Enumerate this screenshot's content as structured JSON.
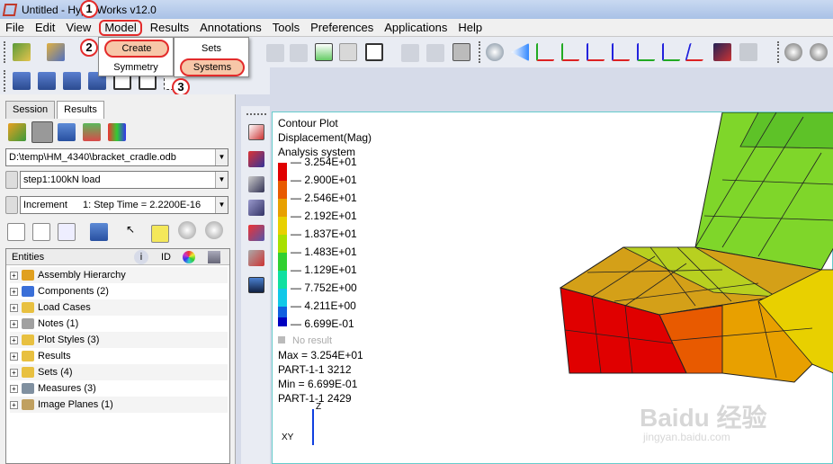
{
  "window": {
    "title": "Untitled - HyperWorks v12.0"
  },
  "menubar": {
    "items": [
      "File",
      "Edit",
      "View",
      "Model",
      "Results",
      "Annotations",
      "Tools",
      "Preferences",
      "Applications",
      "Help"
    ],
    "active": "Model"
  },
  "model_menu": {
    "items": [
      "Create",
      "Symmetry"
    ]
  },
  "create_submenu": {
    "items": [
      "Sets",
      "Systems"
    ]
  },
  "steps": [
    "1",
    "2",
    "3"
  ],
  "left_panel": {
    "tabs": [
      "Session",
      "Results"
    ],
    "file_path": "D:\\temp\\HM_4340\\bracket_cradle.odb",
    "step_value": "step1:100kN load",
    "increment_label": "Increment",
    "increment_value": "1: Step Time =  2.2200E-16",
    "entities_header": {
      "entities": "Entities",
      "id": "ID"
    },
    "entities": [
      {
        "label": "Assembly Hierarchy",
        "color": "#e0a020"
      },
      {
        "label": "Components (2)",
        "color": "#3a6fd8"
      },
      {
        "label": "Load Cases",
        "color": "#e8c040"
      },
      {
        "label": "Notes (1)",
        "color": "#a0a0a0"
      },
      {
        "label": "Plot Styles (3)",
        "color": "#e8c040"
      },
      {
        "label": "Results",
        "color": "#e8c040"
      },
      {
        "label": "Sets  (4)",
        "color": "#e8c040"
      },
      {
        "label": "Measures (3)",
        "color": "#8090a0"
      },
      {
        "label": "Image Planes (1)",
        "color": "#c0a060"
      }
    ]
  },
  "contour": {
    "title_lines": [
      "Contour Plot",
      "Displacement(Mag)",
      "Analysis system"
    ],
    "legend": [
      {
        "value": "3.254E+01",
        "color": "#e00000"
      },
      {
        "value": "2.900E+01",
        "color": "#e85a00"
      },
      {
        "value": "2.546E+01",
        "color": "#e8a000"
      },
      {
        "value": "2.192E+01",
        "color": "#e8d000"
      },
      {
        "value": "1.837E+01",
        "color": "#a8e000"
      },
      {
        "value": "1.483E+01",
        "color": "#30d030"
      },
      {
        "value": "1.129E+01",
        "color": "#10e0a0"
      },
      {
        "value": "7.752E+00",
        "color": "#10c8e8"
      },
      {
        "value": "4.211E+00",
        "color": "#1060e0"
      },
      {
        "value": "6.699E-01",
        "color": "#0000c0"
      }
    ],
    "no_result": "No result",
    "stats": [
      "Max = 3.254E+01",
      "PART-1-1 3212",
      "Min = 6.699E-01",
      "PART-1-1 2429"
    ],
    "axis_label": "Z",
    "axis_label_xy": "XY"
  },
  "watermark": {
    "line1": "Baidu 经验",
    "line2": "jingyan.baidu.com"
  }
}
